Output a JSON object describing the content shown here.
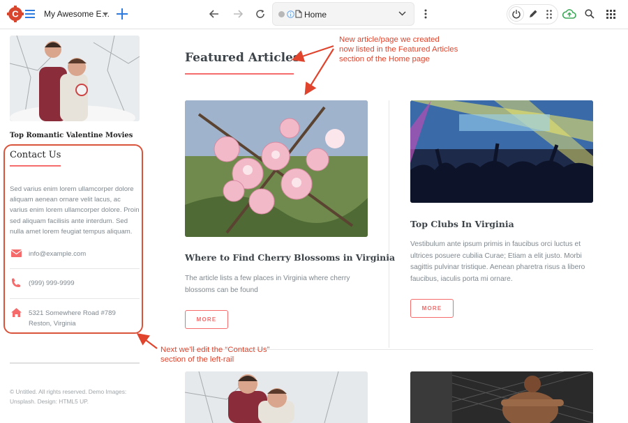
{
  "toolbar": {
    "site_name": "My Awesome E…",
    "address": "Home",
    "colors": {
      "brand_red": "#d9462e",
      "accent_blue": "#2a7ae2",
      "cloud_green": "#3aa757"
    },
    "icons": [
      "logo-icon",
      "hamburger-icon",
      "chevron-down-icon",
      "plus-icon",
      "back-arrow-icon",
      "forward-arrow-icon",
      "reload-icon",
      "info-icon",
      "page-icon",
      "kebab-menu-icon",
      "power-icon",
      "pencil-icon",
      "drag-grip-icon",
      "cloud-upload-icon",
      "search-icon",
      "apps-grid-icon"
    ]
  },
  "sidebar": {
    "featured_caption": "Top Romantic Valentine Movies",
    "contact_title": "Contact Us",
    "contact_text": "Sed varius enim lorem ullamcorper dolore aliquam aenean ornare velit lacus, ac varius enim lorem ullamcorper dolore. Proin sed aliquam facilisis ante interdum. Sed nulla amet lorem feugiat tempus aliquam.",
    "email": "info@example.com",
    "phone": "(999) 999-9999",
    "address_line1": "5321 Somewhere Road #789",
    "address_line2": "Reston, Virginia",
    "footer": "© Untitled. All rights reserved. Demo Images: Unsplash. Design: HTML5 UP."
  },
  "main": {
    "section_title": "Featured Articles",
    "articles": [
      {
        "title": "Where to Find Cherry Blossoms in Virginia",
        "text": "The article lists a few places in Virginia where cherry blossoms can be found",
        "button": "MORE"
      },
      {
        "title": "Top Clubs In Virginia",
        "text": "Vestibulum ante ipsum primis in faucibus orci luctus et ultrices posuere cubilia Curae; Etiam a elit justo. Morbi sagittis pulvinar tristique. Aenean pharetra risus a libero faucibus, iaculis porta mi ornare.",
        "button": "MORE"
      }
    ]
  },
  "annotations": {
    "top_line1": "New article/page we created",
    "top_line2": "now listed in the Featured Articles",
    "top_line3": "section of the Home page",
    "bottom_line1": "Next we’ll edit the “Contact Us”",
    "bottom_line2": "section of the left-rail",
    "color": "#e0442d"
  }
}
